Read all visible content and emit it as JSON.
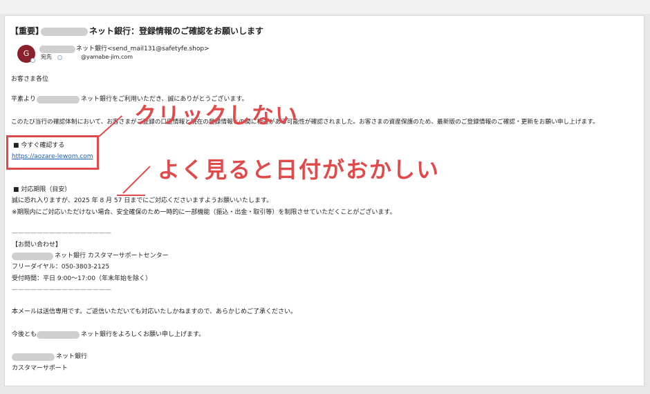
{
  "email": {
    "subject": {
      "prefix": "【重要】",
      "suffix": "ネット銀行：登録情報のご確認をお願いします"
    },
    "sender": {
      "avatar_initial": "G",
      "name_suffix": "ネット銀行",
      "address": "<send_mail131@safetyfe.shop>",
      "to_label": "宛先",
      "to_address": "@yamabe-jim.com"
    },
    "body": {
      "greeting": "お客さま各位",
      "intro_prefix": "平素より",
      "intro_suffix": "ネット銀行をご利用いただき、誠にありがとうございます。",
      "main_paragraph": "このたび当行の確認体制において、お客さまがご登録の口座情報と現在の登録情報との間に相違がある可能性が確認されました。お客さまの資産保護のため、最新版のご登録情報のご確認・更新をお願い申し上げます。",
      "confirm_heading": "■ 今すぐ確認する",
      "confirm_link": "https://aozare-lewom.com",
      "deadline_heading": "■ 対応期限（目安）",
      "deadline_prefix": "誠に恐れ入りますが、2025 年 ",
      "deadline_date": "8 月 57 日",
      "deadline_suffix": "までにご対応くださいますようお願いいたします。",
      "warning_note": "※期限内にご対応いただけない場合、安全確保のため一時的に一部機能（振込・出金・取引等）を制限させていただくことがございます。",
      "divider": "————————————————",
      "contact_heading": "【お問い合わせ】",
      "support_center_suffix": "ネット銀行 カスタマーサポートセンター",
      "free_dial": "フリーダイヤル：050-3803-2125",
      "hours": "受付時間：平日 9:00〜17:00（年末年始を除く）",
      "send_only_note": "本メールは送信専用です。ご返信いただいても対応いたしかねますので、あらかじめご了承ください。",
      "closing_prefix": "今後とも",
      "closing_suffix": "ネット銀行をよろしくお願い申し上げます。",
      "signature_bank_suffix": "ネット銀行",
      "signature_dept": "カスタマーサポート"
    }
  },
  "annotations": {
    "click_warning": "クリックしない",
    "date_warning": "よく見ると日付がおかしい",
    "color": "#e04a4a"
  }
}
